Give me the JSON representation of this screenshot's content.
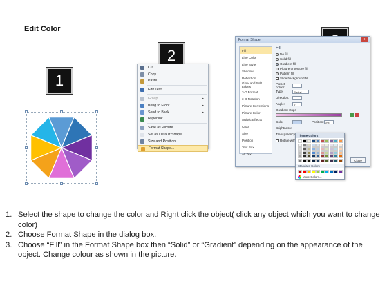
{
  "title": "Edit Color",
  "badges": [
    "1",
    "2",
    "3"
  ],
  "context_menu": {
    "items": [
      {
        "label": "Cut",
        "icon": "scissors-icon",
        "disabled": false,
        "submenu": false
      },
      {
        "label": "Copy",
        "icon": "copy-icon",
        "disabled": false,
        "submenu": false
      },
      {
        "label": "Paste",
        "icon": "paste-icon",
        "disabled": false,
        "submenu": false
      },
      {
        "label": "Edit Text",
        "icon": "edit-text-icon",
        "disabled": false,
        "submenu": false
      },
      {
        "label": "Group",
        "icon": "group-icon",
        "disabled": true,
        "submenu": true
      },
      {
        "label": "Bring to Front",
        "icon": "bring-front-icon",
        "disabled": false,
        "submenu": true
      },
      {
        "label": "Send to Back",
        "icon": "send-back-icon",
        "disabled": false,
        "submenu": true
      },
      {
        "label": "Hyperlink...",
        "icon": "hyperlink-icon",
        "disabled": false,
        "submenu": false
      },
      {
        "label": "Save as Picture...",
        "icon": "save-picture-icon",
        "disabled": false,
        "submenu": false
      },
      {
        "label": "Set as Default Shape",
        "icon": "default-shape-icon",
        "disabled": false,
        "submenu": false
      },
      {
        "label": "Size and Position...",
        "icon": "size-position-icon",
        "disabled": false,
        "submenu": false
      },
      {
        "label": "Format Shape...",
        "icon": "format-shape-icon",
        "disabled": false,
        "submenu": false
      }
    ]
  },
  "format_dialog": {
    "title": "Format Shape",
    "close_label": "x",
    "nav": [
      "Fill",
      "Line Color",
      "Line Style",
      "Shadow",
      "Reflection",
      "Glow and Soft Edges",
      "3-D Format",
      "3-D Rotation",
      "Picture Corrections",
      "Picture Color",
      "Artistic Effects",
      "Crop",
      "Size",
      "Position",
      "Text Box",
      "Alt Text"
    ],
    "fill_heading": "Fill",
    "fill_options": [
      "No fill",
      "Solid fill",
      "Gradient fill",
      "Picture or texture fill",
      "Pattern fill",
      "Slide background fill"
    ],
    "fields": {
      "preset_colors": "Preset colors:",
      "type": "Type:",
      "type_value": "Radial",
      "direction": "Direction:",
      "angle": "Angle:",
      "angle_value": "0°",
      "gradient_stops": "Gradient stops",
      "color": "Color",
      "position": "Position:",
      "position_value": "0%",
      "brightness": "Brightness:",
      "transparency": "Transparency:",
      "rotate": "Rotate with shape"
    },
    "close_button": "Close"
  },
  "color_popup": {
    "theme_heading": "Theme Colors",
    "standard_heading": "Standard Colors",
    "more_colors": "More Colors...",
    "theme_colors": [
      [
        "#ffffff",
        "#000000",
        "#eeece1",
        "#1f497d",
        "#4f81bd",
        "#c0504d",
        "#9bbb59",
        "#8064a2",
        "#4bacc6",
        "#f79646"
      ],
      [
        "#f2f2f2",
        "#7f7f7f",
        "#ddd9c3",
        "#c6d9f0",
        "#dbe5f1",
        "#f2dcdb",
        "#ebf1dd",
        "#e5e0ec",
        "#dbeef3",
        "#fdeada"
      ],
      [
        "#d8d8d8",
        "#595959",
        "#c4bd97",
        "#8db3e2",
        "#b8cce4",
        "#e5b9b7",
        "#d7e3bc",
        "#ccc1d9",
        "#b7dde8",
        "#fbd5b5"
      ],
      [
        "#bfbfbf",
        "#3f3f3f",
        "#938953",
        "#548dd4",
        "#95b3d7",
        "#d99694",
        "#c3d69b",
        "#b2a2c7",
        "#92cddc",
        "#fac08f"
      ],
      [
        "#a5a5a5",
        "#262626",
        "#494429",
        "#17365d",
        "#366092",
        "#953734",
        "#76923c",
        "#5f497a",
        "#31859b",
        "#e36c09"
      ],
      [
        "#7f7f7f",
        "#0c0c0c",
        "#1d1b10",
        "#0f243e",
        "#244061",
        "#632423",
        "#4f6128",
        "#3f3151",
        "#205867",
        "#974806"
      ]
    ],
    "standard_colors": [
      "#c00000",
      "#ff0000",
      "#ffc000",
      "#ffff00",
      "#92d050",
      "#00b050",
      "#00b0f0",
      "#0070c0",
      "#002060",
      "#7030a0"
    ]
  },
  "steps": [
    {
      "num": "1.",
      "text": "Select the shape to change the color and Right click the object( click any object which you want to change color)"
    },
    {
      "num": "2.",
      "text": "Choose Format Shape in the dialog box."
    },
    {
      "num": "3.",
      "text": "Choose “Fill” in the Format Shape box then “Solid” or “Gradient” depending on the appearance of the object. Change colour as shown in the picture."
    }
  ],
  "octagon_colors": [
    "#5b9bd5",
    "#2e75b6",
    "#7030a0",
    "#a05cc8",
    "#e06fd8",
    "#f4a21a",
    "#ffc000",
    "#25b5e8"
  ]
}
